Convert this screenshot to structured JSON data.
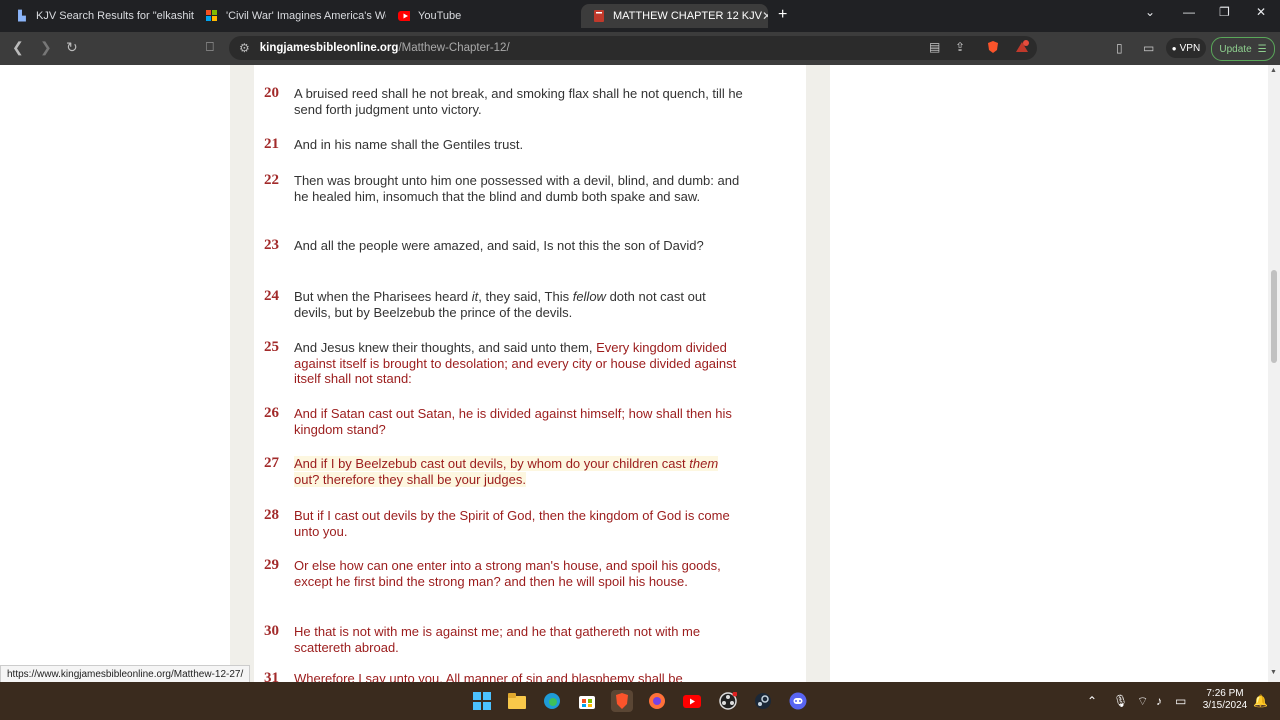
{
  "browser": {
    "tabs": [
      {
        "label": "KJV Search Results for \"elkashite\"",
        "icon": "bible-site-icon"
      },
      {
        "label": "'Civil War' Imagines America's Worst",
        "icon": "msn-icon"
      },
      {
        "label": "YouTube",
        "icon": "youtube-icon"
      },
      {
        "label": "MATTHEW CHAPTER 12 KJV",
        "icon": "bible-site-icon"
      }
    ],
    "url_host": "kingjamesbibleonline.org",
    "url_path": "/Matthew-Chapter-12/",
    "vpn_label": "VPN",
    "update_label": "Update",
    "brave_badge": "1"
  },
  "verses": [
    {
      "num": "20",
      "parts": [
        {
          "t": "A bruised reed shall he not break, and smoking flax shall he not quench, till he send forth judgment unto victory."
        }
      ]
    },
    {
      "num": "21",
      "parts": [
        {
          "t": "And in his name shall the Gentiles trust."
        }
      ]
    },
    {
      "num": "22",
      "parts": [
        {
          "t": "Then was brought unto him one possessed with a devil, blind, and dumb: and he healed him, insomuch that the blind and dumb both spake and saw."
        }
      ]
    },
    {
      "num": "23",
      "parts": [
        {
          "t": "And all the people were amazed, and said, Is not this the son of David?"
        }
      ]
    },
    {
      "num": "24",
      "parts": [
        {
          "t": "But when the Pharisees heard "
        },
        {
          "t": "it",
          "i": true
        },
        {
          "t": ", they said, This "
        },
        {
          "t": "fellow",
          "i": true
        },
        {
          "t": " doth not cast out devils, but by Beelzebub the prince of the devils."
        }
      ]
    },
    {
      "num": "25",
      "parts": [
        {
          "t": "And Jesus knew their thoughts, and said unto them, "
        },
        {
          "t": "Every kingdom divided against itself is brought to desolation; and every city or house divided against itself shall not stand:",
          "r": true
        }
      ]
    },
    {
      "num": "26",
      "parts": [
        {
          "t": "And if Satan cast out Satan, he is divided against himself; how shall then his kingdom stand?",
          "r": true
        }
      ]
    },
    {
      "num": "27",
      "parts": [
        {
          "t": "And if I by Beelzebub cast out devils, by whom do your children cast ",
          "r": true
        },
        {
          "t": "them",
          "r": true,
          "i": true
        },
        {
          "t": " out? therefore they shall be your judges.",
          "r": true
        }
      ],
      "highlight": true
    },
    {
      "num": "28",
      "parts": [
        {
          "t": "But if I cast out devils by the Spirit of God, then the kingdom of God is come unto you.",
          "r": true
        }
      ]
    },
    {
      "num": "29",
      "parts": [
        {
          "t": "Or else how can one enter into a strong man's house, and spoil his goods, except he first bind the strong man? and then he will spoil his house.",
          "r": true
        }
      ]
    },
    {
      "num": "30",
      "parts": [
        {
          "t": "He that is not with me is against me; and he that gathereth not with me scattereth abroad.",
          "r": true
        }
      ]
    },
    {
      "num": "31",
      "parts": [
        {
          "t": "Wherefore I say unto you, All manner of sin and blasphemy shall be",
          "r": true
        }
      ]
    }
  ],
  "status_url": "https://www.kingjamesbibleonline.org/Matthew-12-27/",
  "clock": {
    "time": "7:26 PM",
    "date": "3/15/2024"
  },
  "colors": {
    "verse_number": "#a22a2a",
    "words_of_jesus": "#9b1c1c",
    "highlight": "#fdf7e0"
  }
}
